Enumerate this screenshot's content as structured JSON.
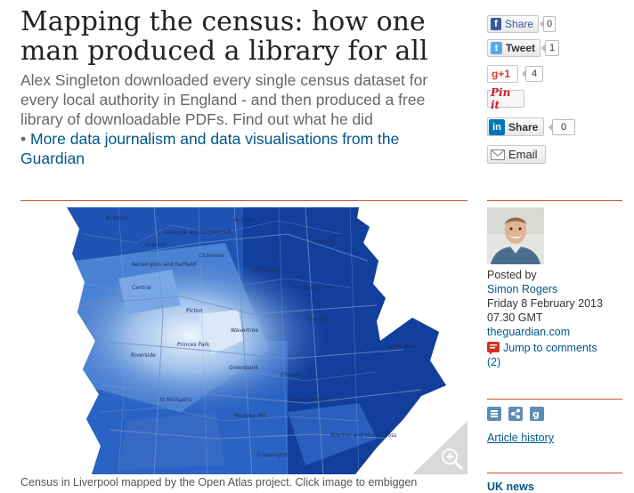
{
  "article": {
    "headline": "Mapping the census: how one man produced a library for all",
    "standfirst": "Alex Singleton downloaded every single census dataset for every local authority in England - and then produced a free library of downloadable PDFs. Find out what he did",
    "bullet": "• ",
    "related_link": "More data journalism and data visualisations from the Guardian",
    "caption": "Census in Liverpool mapped by the Open Atlas project. Click image to embiggen"
  },
  "map_labels": [
    "Kirkdale",
    "Anfield",
    "Everton",
    "Old Swan",
    "Kensington and Fairfield",
    "Central",
    "Picton",
    "Princes Park",
    "Riverside",
    "Wavertree",
    "Church",
    "St Michael's",
    "Mossley Hill",
    "Allerton and Hunts Cross",
    "Cressington",
    "Belle Vale",
    "Greenbank",
    "Tuebrook and Stoneycroft",
    "Knotty Ash",
    "Yew Tree",
    "Clubmoor",
    "Croxteth",
    "Speke-Garston"
  ],
  "share": {
    "facebook": {
      "label": "Share",
      "count": "0"
    },
    "twitter": {
      "label": "Tweet",
      "count": "1"
    },
    "gplus": {
      "label": "+1",
      "count": "4"
    },
    "pinterest": {
      "label": "Pin it"
    },
    "linkedin": {
      "label": "Share",
      "count": "0"
    },
    "email": {
      "label": "Email"
    }
  },
  "byline": {
    "posted_by": "Posted by",
    "author": "Simon Rogers",
    "date": "Friday 8 February 2013",
    "time": "07.30 GMT",
    "site": "theguardian.com",
    "comments": "Jump to comments",
    "comments_count": "(2)"
  },
  "sidebar": {
    "history": "Article history",
    "section": "UK news"
  },
  "colors": {
    "rule": "#c9552e",
    "link": "#005689",
    "map_dark": "#0a3d99",
    "map_light": "#c9dcf5"
  }
}
